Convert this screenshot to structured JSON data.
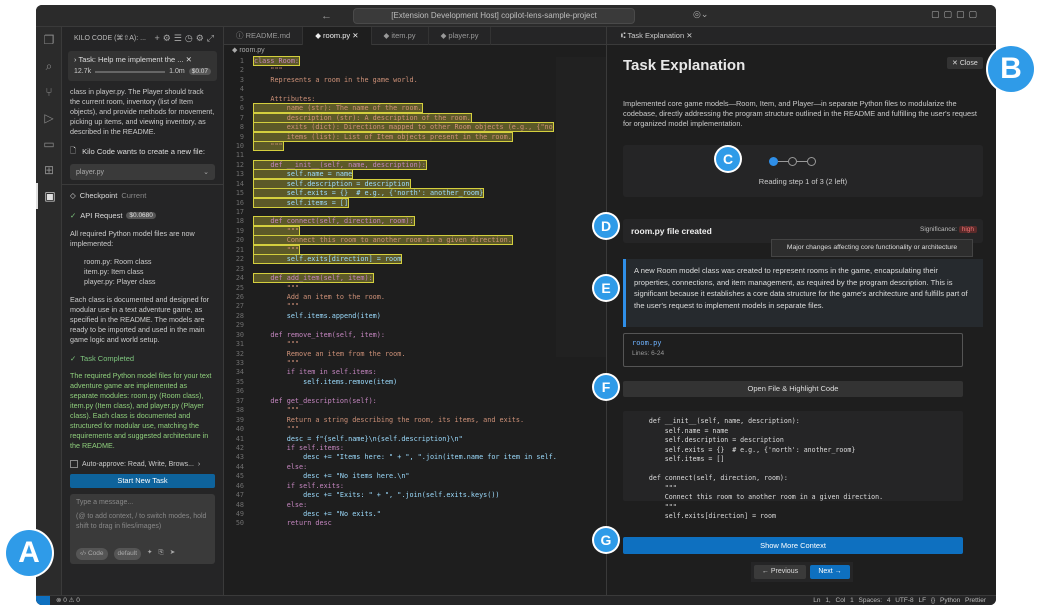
{
  "titlebar": {
    "search": "[Extension Development Host] copilot-lens-sample-project"
  },
  "sidebar": {
    "header": "KILO CODE (⌘⇧A): ...",
    "task_title": "Task: Help me implement the ...",
    "tokens": "12.7k",
    "context": "1.0m",
    "cost": "$0.07",
    "intro": "class in player.py. The Player should track the current room, inventory (list of Item objects), and provide methods for movement, picking up items, and viewing inventory, as described in the README.",
    "create_label": "Kilo Code wants to create a new file:",
    "file_input": "player.py",
    "checkpoint": "Checkpoint",
    "checkpoint_sub": "Current",
    "api_request": "API Request",
    "api_cost": "$0.0680",
    "api_text": "All required Python model files are now implemented:",
    "files": [
      "room.py: Room class",
      "item.py: Item class",
      "player.py: Player class"
    ],
    "summary": "Each class is documented and designed for modular use in a text adventure game, as specified in the README. The models are ready to be imported and used in the main game logic and world setup.",
    "task_completed": "Task Completed",
    "completed_text": "The required Python model files for your text adventure game are implemented as separate modules: room.py (Room class), item.py (Item class), and player.py (Player class). Each class is documented and structured for modular use, matching the requirements and suggested architecture in the README.",
    "auto_approve": "Auto-approve: Read, Write, Brows...",
    "start_btn": "Start New Task",
    "msg_placeholder": "Type a message...",
    "msg_hint": "(@ to add context, / to switch modes, hold shift to drag in files/images)",
    "mode": "Code",
    "model": "default"
  },
  "editor": {
    "tabs": [
      "README.md",
      "room.py",
      "item.py",
      "player.py"
    ],
    "active_tab": "room.py",
    "breadcrumb": "room.py",
    "lines": [
      {
        "n": "1",
        "t": "class Room:",
        "h": true
      },
      {
        "n": "2",
        "t": "    \"\"\"",
        "h": false
      },
      {
        "n": "3",
        "t": "    Represents a room in the game world.",
        "h": false
      },
      {
        "n": "4",
        "t": "",
        "h": false
      },
      {
        "n": "5",
        "t": "    Attributes:",
        "h": false
      },
      {
        "n": "6",
        "t": "        name (str): The name of the room.",
        "h": true
      },
      {
        "n": "7",
        "t": "        description (str): A description of the room.",
        "h": true
      },
      {
        "n": "8",
        "t": "        exits (dict): Directions mapped to other Room objects (e.g., {\"no",
        "h": true
      },
      {
        "n": "9",
        "t": "        items (list): List of Item objects present in the room.",
        "h": true
      },
      {
        "n": "10",
        "t": "    \"\"\"",
        "h": true
      },
      {
        "n": "11",
        "t": "",
        "h": false
      },
      {
        "n": "12",
        "t": "    def __init__(self, name, description):",
        "h": true
      },
      {
        "n": "13",
        "t": "        self.name = name",
        "h": true
      },
      {
        "n": "14",
        "t": "        self.description = description",
        "h": true
      },
      {
        "n": "15",
        "t": "        self.exits = {}  # e.g., {'north': another_room}",
        "h": true
      },
      {
        "n": "16",
        "t": "        self.items = []",
        "h": true
      },
      {
        "n": "17",
        "t": "",
        "h": false
      },
      {
        "n": "18",
        "t": "    def connect(self, direction, room):",
        "h": true
      },
      {
        "n": "19",
        "t": "        \"\"\"",
        "h": true
      },
      {
        "n": "20",
        "t": "        Connect this room to another room in a given direction.",
        "h": true
      },
      {
        "n": "21",
        "t": "        \"\"\"",
        "h": true
      },
      {
        "n": "22",
        "t": "        self.exits[direction] = room",
        "h": true
      },
      {
        "n": "23",
        "t": "",
        "h": false
      },
      {
        "n": "24",
        "t": "    def add_item(self, item):",
        "h": true
      },
      {
        "n": "25",
        "t": "        \"\"\"",
        "h": false
      },
      {
        "n": "26",
        "t": "        Add an item to the room.",
        "h": false
      },
      {
        "n": "27",
        "t": "        \"\"\"",
        "h": false
      },
      {
        "n": "28",
        "t": "        self.items.append(item)",
        "h": false
      },
      {
        "n": "29",
        "t": "",
        "h": false
      },
      {
        "n": "30",
        "t": "    def remove_item(self, item):",
        "h": false
      },
      {
        "n": "31",
        "t": "        \"\"\"",
        "h": false
      },
      {
        "n": "32",
        "t": "        Remove an item from the room.",
        "h": false
      },
      {
        "n": "33",
        "t": "        \"\"\"",
        "h": false
      },
      {
        "n": "34",
        "t": "        if item in self.items:",
        "h": false
      },
      {
        "n": "35",
        "t": "            self.items.remove(item)",
        "h": false
      },
      {
        "n": "36",
        "t": "",
        "h": false
      },
      {
        "n": "37",
        "t": "    def get_description(self):",
        "h": false
      },
      {
        "n": "38",
        "t": "        \"\"\"",
        "h": false
      },
      {
        "n": "39",
        "t": "        Return a string describing the room, its items, and exits.",
        "h": false
      },
      {
        "n": "40",
        "t": "        \"\"\"",
        "h": false
      },
      {
        "n": "41",
        "t": "        desc = f\"{self.name}\\n{self.description}\\n\"",
        "h": false
      },
      {
        "n": "42",
        "t": "        if self.items:",
        "h": false
      },
      {
        "n": "43",
        "t": "            desc += \"Items here: \" + \", \".join(item.name for item in self.",
        "h": false
      },
      {
        "n": "44",
        "t": "        else:",
        "h": false
      },
      {
        "n": "45",
        "t": "            desc += \"No items here.\\n\"",
        "h": false
      },
      {
        "n": "46",
        "t": "        if self.exits:",
        "h": false
      },
      {
        "n": "47",
        "t": "            desc += \"Exits: \" + \", \".join(self.exits.keys())",
        "h": false
      },
      {
        "n": "48",
        "t": "        else:",
        "h": false
      },
      {
        "n": "49",
        "t": "            desc += \"No exits.\"",
        "h": false
      },
      {
        "n": "50",
        "t": "        return desc",
        "h": false
      }
    ]
  },
  "panel": {
    "tab": "Task Explanation",
    "title": "Task Explanation",
    "close": "Close",
    "description": "Implemented core game models—Room, Item, and Player—in separate Python files to modularize the codebase, directly addressing the program structure outlined in the README and fulfilling the user's request for organized model implementation.",
    "step_label": "Reading step 1 of 3 (2 left)",
    "step_current": 1,
    "step_total": 3,
    "file_title": "room.py file created",
    "significance_label": "Significance:",
    "significance": "high",
    "tooltip": "Major changes affecting core functionality or architecture",
    "explanation": "A new Room model class was created to represent rooms in the game, encapsulating their properties, connections, and item management, as required by the program description. This is significant because it establishes a core data structure for the game's architecture and fulfills part of the user's request to implement models in separate files.",
    "file_name": "room.py",
    "file_lines": "Lines: 6-24",
    "open_btn": "Open File & Highlight Code",
    "snippet": [
      "    def __init__(self, name, description):",
      "        self.name = name",
      "        self.description = description",
      "        self.exits = {}  # e.g., {'north': another_room}",
      "        self.items = []",
      "",
      "    def connect(self, direction, room):",
      "        \"\"\"",
      "        Connect this room to another room in a given direction.",
      "        \"\"\"",
      "        self.exits[direction] = room"
    ],
    "more_btn": "Show More Context",
    "prev_btn": "← Previous",
    "next_btn": "Next →"
  },
  "status": {
    "left": "⊗ 0 ⚠ 0",
    "right": "Ln 1, Col 1   Spaces: 4   UTF-8   LF   {} Python   Prettier"
  },
  "badges": [
    "A",
    "B",
    "C",
    "D",
    "E",
    "F",
    "G"
  ]
}
